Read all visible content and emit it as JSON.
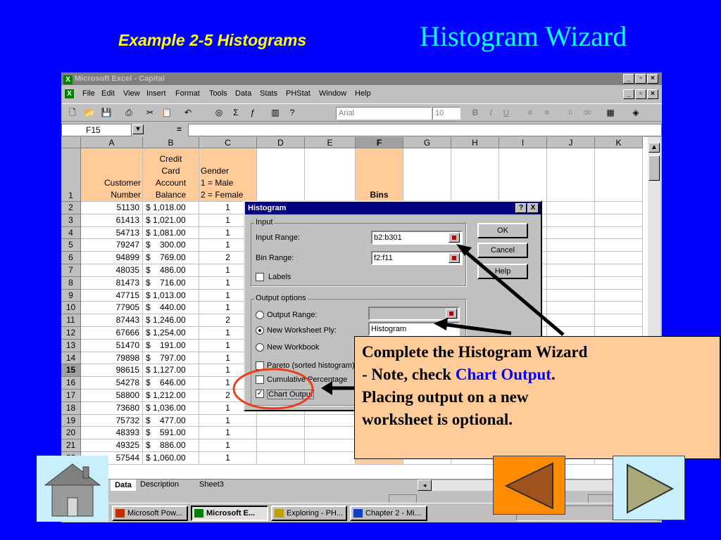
{
  "slide": {
    "title_left": "Example 2-5 Histograms",
    "title_right": "Histogram Wizard",
    "note": {
      "line1": "Complete the Histogram Wizard",
      "line2_prefix": "- Note, check ",
      "line2_highlight": "Chart Output",
      "line2_suffix": ".",
      "line3": "Placing output on a new",
      "line4": "worksheet is optional."
    }
  },
  "excel": {
    "app_title": "Microsoft Excel - Capital",
    "menu": [
      "File",
      "Edit",
      "View",
      "Insert",
      "Format",
      "Tools",
      "Data",
      "Stats",
      "PHStat",
      "Window",
      "Help"
    ],
    "font_name": "Arial",
    "font_size": "10",
    "name_box": "F15",
    "formula_eq": "=",
    "columns": [
      "A",
      "B",
      "C",
      "D",
      "E",
      "F",
      "G",
      "H",
      "I",
      "J",
      "K"
    ],
    "header": {
      "row": "1",
      "a1": "Customer",
      "a2": "Number",
      "b1": "Credit",
      "b2": "Card",
      "b3": "Account",
      "b4": "Balance",
      "c1": "Gender",
      "c2": "1 =   Male",
      "c3": "2 = Female",
      "f": "Bins"
    },
    "rows": [
      {
        "n": "2",
        "a": "51130",
        "b": "$ 1,018.00",
        "c": "1"
      },
      {
        "n": "3",
        "a": "61413",
        "b": "$ 1,021.00",
        "c": "1"
      },
      {
        "n": "4",
        "a": "54713",
        "b": "$ 1,081.00",
        "c": "1"
      },
      {
        "n": "5",
        "a": "79247",
        "b": "$    300.00",
        "c": "1"
      },
      {
        "n": "6",
        "a": "94899",
        "b": "$    769.00",
        "c": "2"
      },
      {
        "n": "7",
        "a": "48035",
        "b": "$    486.00",
        "c": "1"
      },
      {
        "n": "8",
        "a": "81473",
        "b": "$    716.00",
        "c": "1"
      },
      {
        "n": "9",
        "a": "47715",
        "b": "$ 1,013.00",
        "c": "1"
      },
      {
        "n": "10",
        "a": "77905",
        "b": "$    440.00",
        "c": "1"
      },
      {
        "n": "11",
        "a": "87443",
        "b": "$ 1,246.00",
        "c": "2"
      },
      {
        "n": "12",
        "a": "67666",
        "b": "$ 1,254.00",
        "c": "1"
      },
      {
        "n": "13",
        "a": "51470",
        "b": "$    191.00",
        "c": "1"
      },
      {
        "n": "14",
        "a": "79898",
        "b": "$    797.00",
        "c": "1"
      },
      {
        "n": "15",
        "a": "98615",
        "b": "$ 1,127.00",
        "c": "1"
      },
      {
        "n": "16",
        "a": "54278",
        "b": "$    646.00",
        "c": "1"
      },
      {
        "n": "17",
        "a": "58800",
        "b": "$ 1,212.00",
        "c": "2"
      },
      {
        "n": "18",
        "a": "73680",
        "b": "$ 1,036.00",
        "c": "1"
      },
      {
        "n": "19",
        "a": "75732",
        "b": "$    477.00",
        "c": "1"
      },
      {
        "n": "20",
        "a": "48393",
        "b": "$    591.00",
        "c": "1"
      },
      {
        "n": "21",
        "a": "49325",
        "b": "$    886.00",
        "c": "1"
      },
      {
        "n": "22",
        "a": "57544",
        "b": "$ 1,060.00",
        "c": "1"
      }
    ],
    "sheet_tabs": [
      "Data",
      "Description",
      "Sheet3"
    ],
    "taskbar": [
      "Microsoft Pow...",
      "Microsoft E...",
      "Exploring - PH...",
      "Chapter 2 - Mi..."
    ]
  },
  "dialog": {
    "title": "Histogram",
    "help_btn": "?",
    "close_btn": "X",
    "input_group": "Input",
    "input_range_label": "Input Range:",
    "input_range_value": "b2:b301",
    "bin_range_label": "Bin Range:",
    "bin_range_value": "f2:f11",
    "labels_label": "Labels",
    "output_group": "Output options",
    "output_range_label": "Output Range:",
    "new_ply_label": "New Worksheet Ply:",
    "new_ply_value": "Histogram",
    "new_workbook_label": "New Workbook",
    "pareto_label": "Pareto (sorted histogram)",
    "cumulative_label": "Cumulative Percentage",
    "chart_output_label": "Chart Output",
    "ok": "OK",
    "cancel": "Cancel",
    "help": "Help"
  },
  "colors": {
    "background": "#0000ff",
    "title_left": "#ffff00",
    "title_right": "#00ffff",
    "note_bg": "#ffcc99",
    "highlight": "#0000ff",
    "callout_circle": "#e8401c"
  },
  "icons": {
    "home": "home-icon",
    "prev": "triangle-left-icon",
    "next": "triangle-right-icon"
  }
}
